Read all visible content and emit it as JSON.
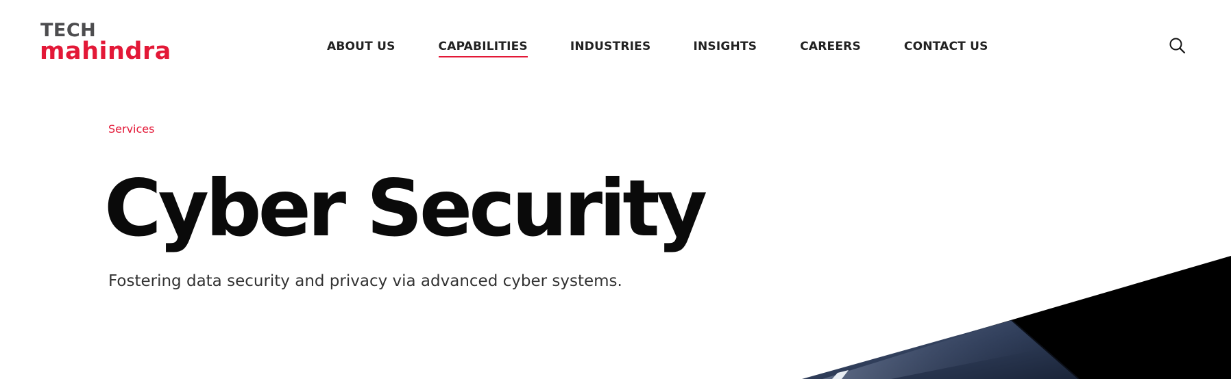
{
  "header": {
    "logo": {
      "line1": "TECH",
      "line2": "mahindra"
    },
    "nav": [
      {
        "label": "ABOUT US",
        "active": false
      },
      {
        "label": "CAPABILITIES",
        "active": true
      },
      {
        "label": "INDUSTRIES",
        "active": false
      },
      {
        "label": "INSIGHTS",
        "active": false
      },
      {
        "label": "CAREERS",
        "active": false
      },
      {
        "label": "CONTACT US",
        "active": false
      }
    ],
    "search_icon": "search-icon"
  },
  "hero": {
    "breadcrumb": "Services",
    "title": "Cyber Security",
    "subtitle": "Fostering data security and privacy via advanced cyber systems."
  },
  "colors": {
    "brand_red": "#e31837",
    "logo_grey": "#4d4d4f",
    "text_dark": "#0a0a0a"
  }
}
